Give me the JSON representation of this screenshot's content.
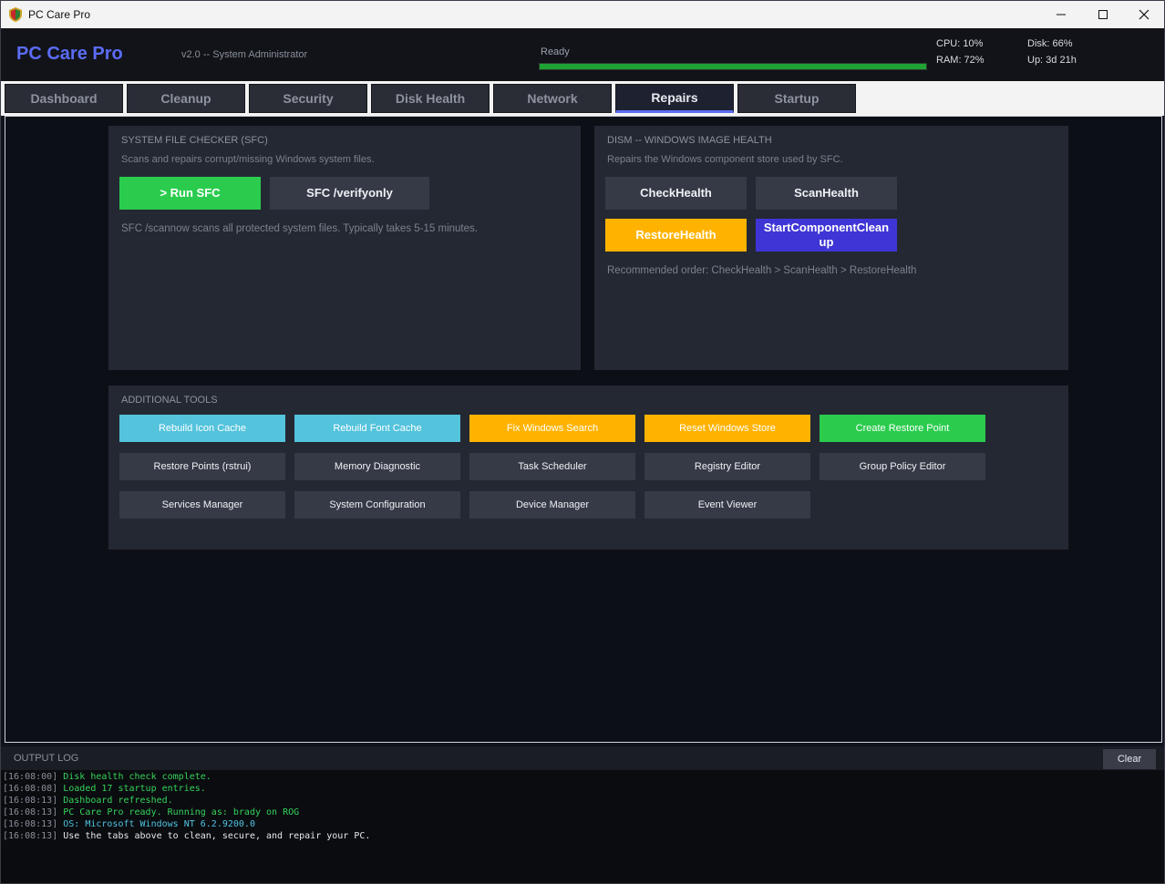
{
  "window": {
    "title": "PC Care Pro"
  },
  "header": {
    "brand": "PC Care Pro",
    "version": "v2.0  --  System Administrator",
    "status": "Ready",
    "progress": 1.0,
    "stats": {
      "cpu": "CPU: 10%",
      "ram": "RAM: 72%",
      "disk": "Disk: 66%",
      "uptime": "Up: 3d 21h"
    }
  },
  "tabs": [
    {
      "label": "Dashboard"
    },
    {
      "label": "Cleanup"
    },
    {
      "label": "Security"
    },
    {
      "label": "Disk Health"
    },
    {
      "label": "Network"
    },
    {
      "label": "Repairs",
      "active": true
    },
    {
      "label": "Startup"
    }
  ],
  "sfc": {
    "title": "SYSTEM FILE CHECKER (SFC)",
    "desc": "Scans and repairs corrupt/missing Windows system files.",
    "run_label": ">  Run SFC",
    "verify_label": "SFC /verifyonly",
    "note": "SFC /scannow scans all protected system files. Typically takes 5-15 minutes."
  },
  "dism": {
    "title": "DISM -- WINDOWS IMAGE HEALTH",
    "desc": "Repairs the Windows component store used by SFC.",
    "checkhealth": "CheckHealth",
    "scanhealth": "ScanHealth",
    "restorehealth": "RestoreHealth",
    "cleanup": "StartComponentCleanup",
    "note": "Recommended order: CheckHealth > ScanHealth > RestoreHealth"
  },
  "tools": {
    "title": "ADDITIONAL TOOLS",
    "buttons": [
      "Rebuild Icon Cache",
      "Rebuild Font Cache",
      "Fix Windows Search",
      "Reset Windows Store",
      "Create Restore Point",
      "Restore Points (rstrui)",
      "Memory Diagnostic",
      "Task Scheduler",
      "Registry Editor",
      "Group Policy Editor",
      "Services Manager",
      "System Configuration",
      "Device Manager",
      "Event Viewer"
    ]
  },
  "log": {
    "title": "OUTPUT LOG",
    "clear": "Clear",
    "lines": [
      {
        "time": "[16:08:00]",
        "text": "Disk health check complete."
      },
      {
        "time": "[16:08:08]",
        "text": "Loaded 17 startup entries."
      },
      {
        "time": "[16:08:13]",
        "text": "Dashboard refreshed."
      },
      {
        "time": "[16:08:13]",
        "text": "PC Care Pro ready. Running as: brady on ROG"
      },
      {
        "time": "[16:08:13]",
        "text": "OS: Microsoft Windows NT 6.2.9200.0"
      },
      {
        "time": "[16:08:13]",
        "text": "Use the tabs above to clean, secure, and repair your PC."
      }
    ]
  },
  "colors": {
    "accent": "#5b6cf5",
    "green": "#2bcc4e",
    "orange": "#ffb300",
    "purple": "#3f35d6",
    "cyan": "#54c3dc"
  }
}
